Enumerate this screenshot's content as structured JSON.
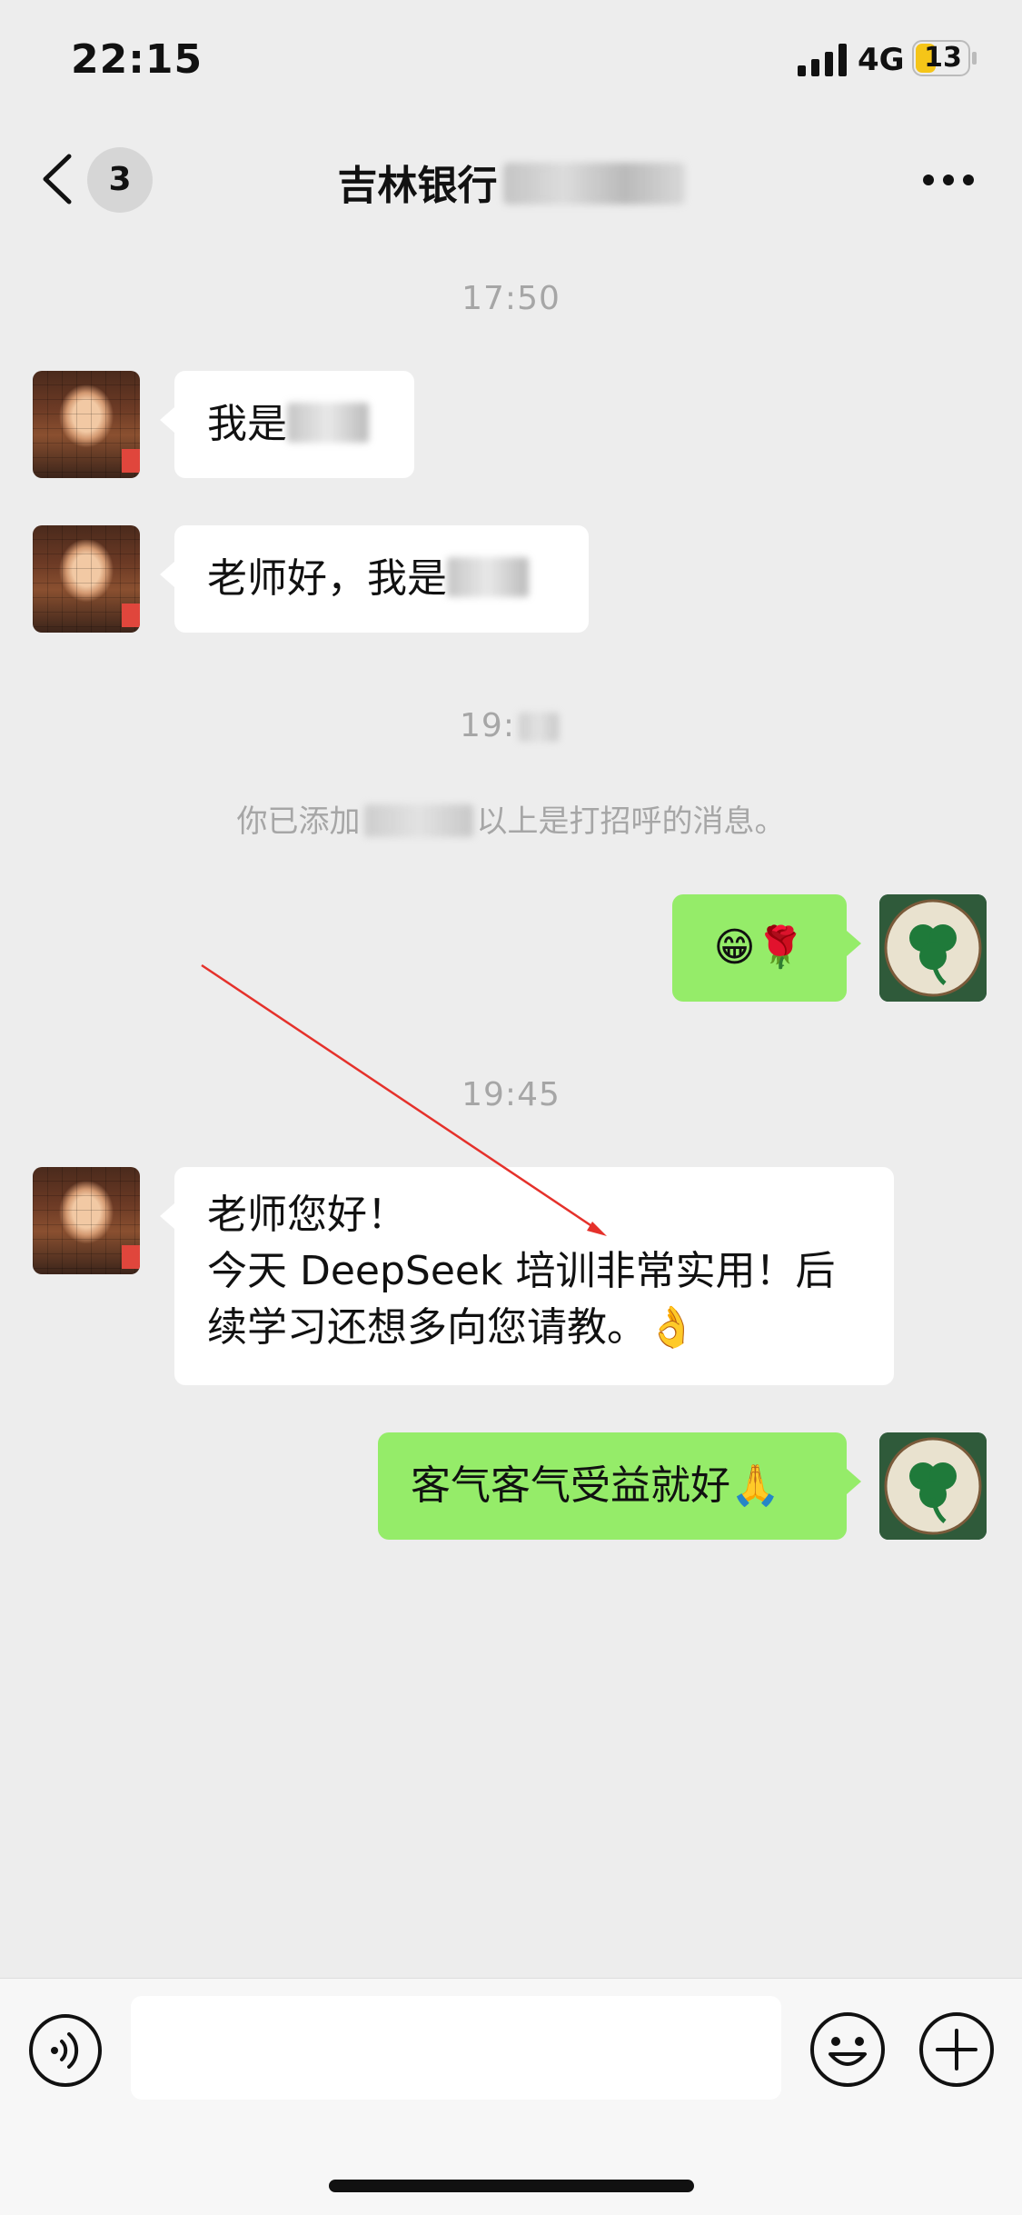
{
  "status_bar": {
    "time": "22:15",
    "network": "4G",
    "battery": "13",
    "signal_icon": "cellular-signal-icon",
    "battery_icon": "battery-icon"
  },
  "nav": {
    "back_icon": "chevron-left-icon",
    "unread_count": "3",
    "title": "吉林银行",
    "more_icon": "more-dots-icon"
  },
  "messages": [
    {
      "type": "time",
      "text": "17:50"
    },
    {
      "type": "incoming",
      "text": "我是"
    },
    {
      "type": "incoming",
      "text": "老师好，我是"
    },
    {
      "type": "time",
      "text": "19:"
    },
    {
      "type": "system",
      "text_before": "你已添加",
      "text_after": "以上是打招呼的消息。"
    },
    {
      "type": "outgoing",
      "text": "😁🌹"
    },
    {
      "type": "time",
      "text": "19:45"
    },
    {
      "type": "incoming",
      "lines": [
        "老师您好！",
        "今天 DeepSeek 培训非常实用！后",
        "续学习还想多向您请教。👌"
      ]
    },
    {
      "type": "outgoing",
      "text": "客气客气受益就好🙏"
    }
  ],
  "input_bar": {
    "voice_icon": "voice-icon",
    "emoji_icon": "emoji-icon",
    "plus_icon": "plus-icon",
    "input_value": ""
  },
  "colors": {
    "background": "#ededed",
    "incoming_bubble": "#ffffff",
    "outgoing_bubble": "#95ec69",
    "time_text": "#a6a6a6",
    "annotation_arrow": "#e5312b"
  }
}
